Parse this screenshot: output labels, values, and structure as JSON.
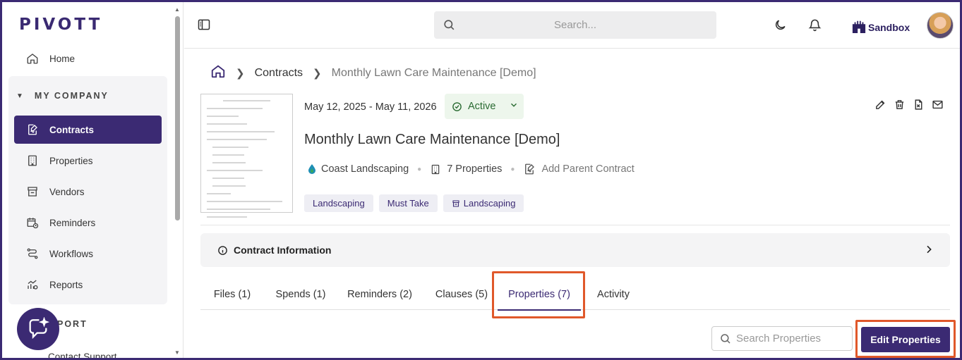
{
  "app": {
    "logo": "PIVOTT"
  },
  "sidebar": {
    "home_label": "Home",
    "group_title": "MY COMPANY",
    "items": [
      {
        "label": "Contracts",
        "icon": "contract-sign-icon",
        "active": true
      },
      {
        "label": "Properties",
        "icon": "building-icon"
      },
      {
        "label": "Vendors",
        "icon": "store-icon"
      },
      {
        "label": "Reminders",
        "icon": "calendar-clock-icon"
      },
      {
        "label": "Workflows",
        "icon": "workflow-icon"
      },
      {
        "label": "Reports",
        "icon": "reports-icon"
      }
    ],
    "support_title": "PORT",
    "contact_support": "Contact Support"
  },
  "topbar": {
    "search_placeholder": "Search...",
    "sandbox_label": "Sandbox"
  },
  "breadcrumb": {
    "level1": "Contracts",
    "current": "Monthly Lawn Care Maintenance [Demo]"
  },
  "contract": {
    "dates": "May 12, 2025 - May 11, 2026",
    "status": "Active",
    "title": "Monthly Lawn Care Maintenance [Demo]",
    "vendor": "Coast Landscaping",
    "properties_count": "7 Properties",
    "add_parent": "Add Parent Contract",
    "tags": [
      {
        "label": "Landscaping"
      },
      {
        "label": "Must Take"
      },
      {
        "label": "Landscaping",
        "icon": "store-icon"
      }
    ]
  },
  "accordion": {
    "label": "Contract Information"
  },
  "tabs": [
    {
      "label": "Files (1)"
    },
    {
      "label": "Spends (1)"
    },
    {
      "label": "Reminders (2)"
    },
    {
      "label": "Clauses (5)"
    },
    {
      "label": "Properties (7)",
      "active": true
    },
    {
      "label": "Activity"
    }
  ],
  "properties_panel": {
    "search_placeholder": "Search Properties",
    "edit_button": "Edit Properties"
  },
  "colors": {
    "brand": "#3b2a73",
    "status_bg": "#edf6ec",
    "status_text": "#2a6b32",
    "highlight": "#e0582a"
  }
}
